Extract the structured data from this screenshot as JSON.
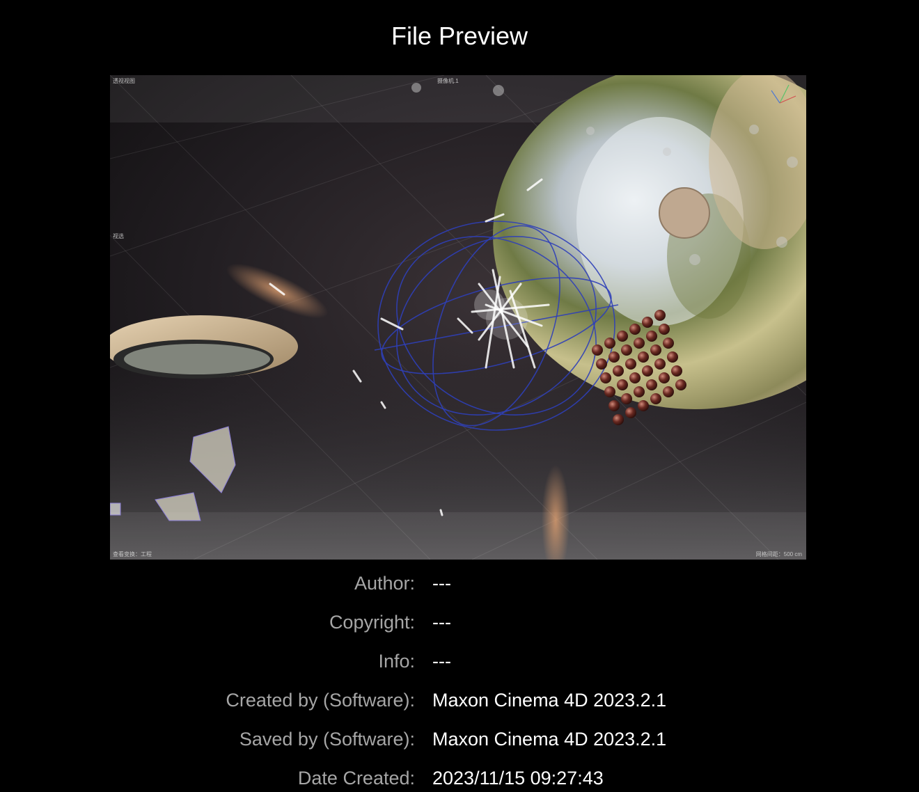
{
  "window": {
    "title": "File Preview"
  },
  "preview": {
    "viewport_labels": {
      "top_left": "透视视图",
      "top_center": "摄像机.1",
      "left_mid": "视选",
      "bottom_left": "查看变换：工程",
      "bottom_right": "网格间距：500 cm"
    }
  },
  "metadata": [
    {
      "label": "Author:",
      "value": "---"
    },
    {
      "label": "Copyright:",
      "value": "---"
    },
    {
      "label": "Info:",
      "value": "---"
    },
    {
      "label": "Created by (Software):",
      "value": "Maxon Cinema 4D 2023.2.1"
    },
    {
      "label": "Saved by (Software):",
      "value": "Maxon Cinema 4D 2023.2.1"
    },
    {
      "label": "Date Created:",
      "value": "2023/11/15 09:27:43"
    }
  ]
}
